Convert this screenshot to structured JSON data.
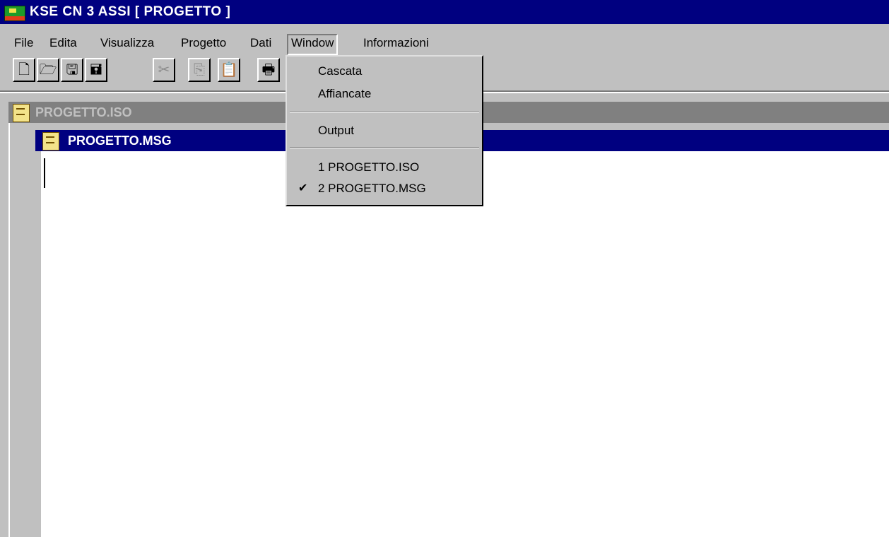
{
  "window": {
    "title": "KSE CN 3 ASSI [ PROGETTO ]"
  },
  "menubar": {
    "items": [
      {
        "label": "File"
      },
      {
        "label": "Edita"
      },
      {
        "label": "Visualizza"
      },
      {
        "label": "Progetto"
      },
      {
        "label": "Dati"
      },
      {
        "label": "Window"
      },
      {
        "label": "Informazioni"
      }
    ]
  },
  "toolbar": {
    "buttons": [
      {
        "icon": "new-document-icon"
      },
      {
        "icon": "open-folder-icon"
      },
      {
        "icon": "save-icon"
      },
      {
        "icon": "save-all-icon"
      },
      {
        "icon": "cut-icon"
      },
      {
        "icon": "copy-icon"
      },
      {
        "icon": "paste-icon"
      },
      {
        "icon": "print-icon"
      }
    ]
  },
  "mdi": {
    "iso_title": "PROGETTO.ISO",
    "msg_title": "PROGETTO.MSG"
  },
  "window_menu": {
    "items": [
      {
        "label": "Cascata",
        "checked": false
      },
      {
        "label": "Affiancate",
        "checked": false
      },
      {
        "label": "Output",
        "checked": false
      },
      {
        "label": "1 PROGETTO.ISO",
        "checked": false
      },
      {
        "label": "2 PROGETTO.MSG",
        "checked": true
      }
    ],
    "check_glyph": "✔"
  }
}
